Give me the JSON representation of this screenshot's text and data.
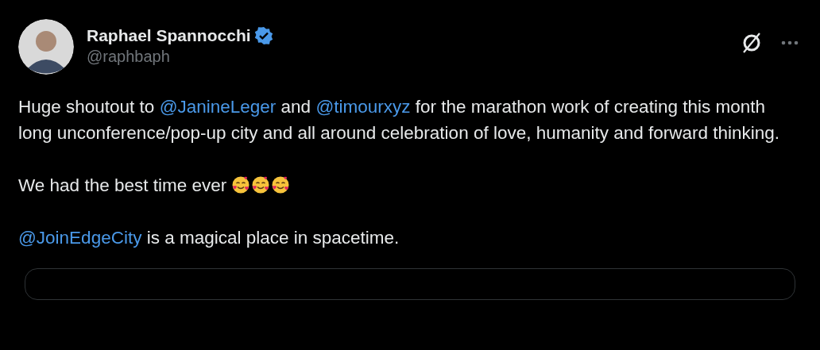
{
  "author": {
    "name": "Raphael Spannocchi",
    "verified": true,
    "handle": "@raphbaph"
  },
  "paragraphs": [
    {
      "segments": [
        {
          "kind": "text",
          "text": "Huge shoutout to "
        },
        {
          "kind": "mention",
          "text": "@JanineLeger"
        },
        {
          "kind": "text",
          "text": " and "
        },
        {
          "kind": "mention",
          "text": "@timourxyz"
        },
        {
          "kind": "text",
          "text": " for the marathon work of creating this month long unconference/pop-up city and all around celebration of love, humanity and forward thinking."
        }
      ]
    },
    {
      "segments": [
        {
          "kind": "text",
          "text": "We had the best time ever "
        },
        {
          "kind": "emoji"
        },
        {
          "kind": "emoji"
        },
        {
          "kind": "emoji"
        }
      ]
    },
    {
      "segments": [
        {
          "kind": "mention",
          "text": "@JoinEdgeCity"
        },
        {
          "kind": "text",
          "text": " is a magical place in spacetime."
        }
      ]
    }
  ]
}
